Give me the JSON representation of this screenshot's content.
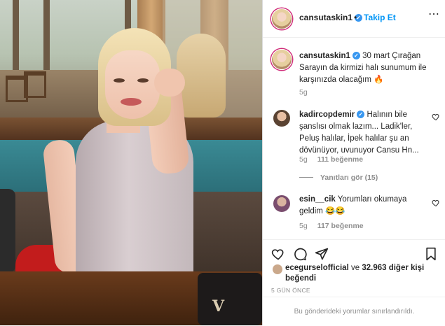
{
  "header": {
    "username": "cansutaskin1",
    "follow_label": "Takip Et",
    "separator": "•",
    "more_icon": "more-horizontal-icon",
    "verified_icon": "verified-badge-icon"
  },
  "caption": {
    "username": "cansutaskin1",
    "text": "30 mart Çırağan Sarayın da kirmizi halı sunumum ile karşınızda olacağım 🔥",
    "age": "5g"
  },
  "comments": [
    {
      "username": "kadircopdemir",
      "text": "Halının bile şanslısı olmak lazım... Ladik'ler, Peluş halılar, İpek halılar şu an dövünüyor, uvunuyor Cansu Hn...",
      "age": "5g",
      "likes": "111 beğenme",
      "replies": "Yanıtları gör (15)"
    },
    {
      "username": "esin__cik",
      "text": "Yorumları okumaya geldim 😂😂",
      "age": "5g",
      "likes": "117 beğenme"
    }
  ],
  "actions": {
    "like_icon": "heart-icon",
    "comment_icon": "comment-bubble-icon",
    "share_icon": "paper-plane-icon",
    "save_icon": "bookmark-icon"
  },
  "likes": {
    "user": "ecegurselofficial",
    "connector": "ve",
    "count": "32.963 diğer kişi",
    "suffix": "beğendi"
  },
  "date": "5 GÜN ÖNCE",
  "footer": "Bu gönderideki yorumlar sınırlandırıldı.",
  "colors": {
    "accent": "#0095f6",
    "verified": "#3897f0",
    "text": "#262626",
    "muted": "#8e8e8e"
  }
}
